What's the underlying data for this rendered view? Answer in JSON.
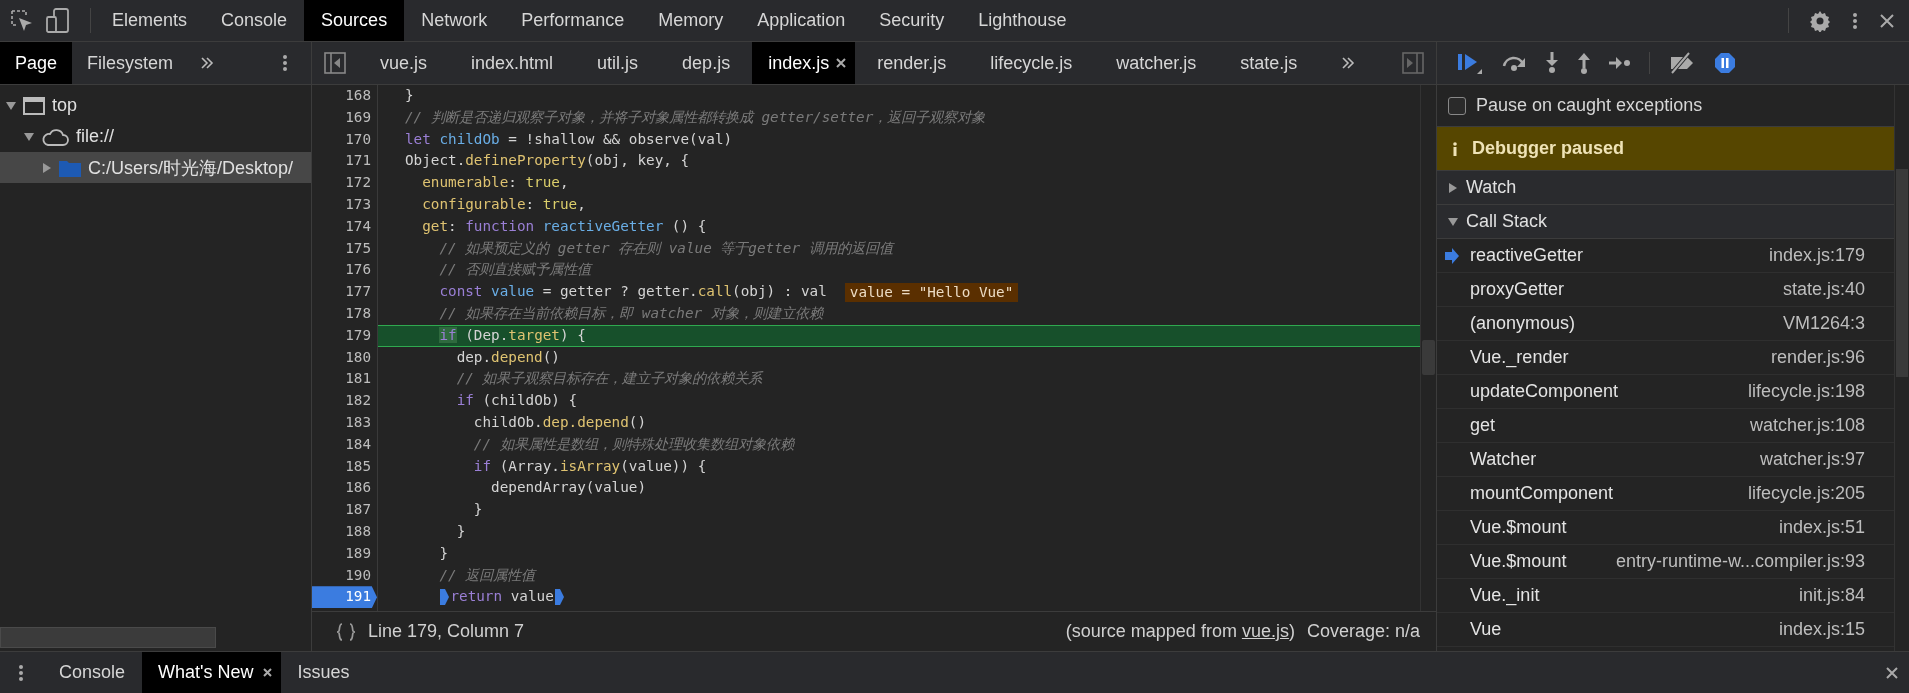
{
  "main_tabs": [
    {
      "label": "Elements",
      "selected": false
    },
    {
      "label": "Console",
      "selected": false
    },
    {
      "label": "Sources",
      "selected": true
    },
    {
      "label": "Network",
      "selected": false
    },
    {
      "label": "Performance",
      "selected": false
    },
    {
      "label": "Memory",
      "selected": false
    },
    {
      "label": "Application",
      "selected": false
    },
    {
      "label": "Security",
      "selected": false
    },
    {
      "label": "Lighthouse",
      "selected": false
    }
  ],
  "navigator": {
    "tabs": [
      {
        "label": "Page",
        "selected": true
      },
      {
        "label": "Filesystem",
        "selected": false
      }
    ],
    "tree": [
      {
        "label": "top",
        "kind": "frame",
        "expanded": true,
        "selected": false,
        "children": [
          {
            "label": "file://",
            "kind": "origin",
            "expanded": true,
            "selected": false,
            "children": [
              {
                "label": "C:/Users/时光海/Desktop/",
                "kind": "folder",
                "expanded": false,
                "selected": true
              }
            ]
          }
        ]
      }
    ]
  },
  "editor": {
    "tabs": [
      {
        "label": "vue.js",
        "selected": false
      },
      {
        "label": "index.html",
        "selected": false
      },
      {
        "label": "util.js",
        "selected": false
      },
      {
        "label": "dep.js",
        "selected": false
      },
      {
        "label": "index.js",
        "selected": true
      },
      {
        "label": "render.js",
        "selected": false
      },
      {
        "label": "lifecycle.js",
        "selected": false
      },
      {
        "label": "watcher.js",
        "selected": false
      },
      {
        "label": "state.js",
        "selected": false
      }
    ],
    "lines": [
      {
        "number": "168",
        "current": false,
        "breakpoint": false,
        "tokens": [
          {
            "kind": "plain",
            "text": "}"
          }
        ]
      },
      {
        "number": "169",
        "current": false,
        "breakpoint": false,
        "tokens": [
          {
            "kind": "comment",
            "text": "// 判断是否递归观察子对象，并将子对象属性都转换成 getter/setter，返回子观察对象"
          }
        ]
      },
      {
        "number": "170",
        "current": false,
        "breakpoint": false,
        "tokens": [
          {
            "kind": "keyword",
            "text": "let"
          },
          {
            "kind": "def",
            "text": " childOb"
          },
          {
            "kind": "plain",
            "text": " = !shallow && observe(val)"
          }
        ]
      },
      {
        "number": "171",
        "current": false,
        "breakpoint": false,
        "tokens": [
          {
            "kind": "plain",
            "text": "Object."
          },
          {
            "kind": "prop",
            "text": "defineProperty"
          },
          {
            "kind": "plain",
            "text": "(obj, key, {"
          }
        ]
      },
      {
        "number": "172",
        "current": false,
        "breakpoint": false,
        "tokens": [
          {
            "kind": "prop",
            "text": "  enumerable"
          },
          {
            "kind": "plain",
            "text": ": "
          },
          {
            "kind": "atom",
            "text": "true"
          },
          {
            "kind": "plain",
            "text": ","
          }
        ]
      },
      {
        "number": "173",
        "current": false,
        "breakpoint": false,
        "tokens": [
          {
            "kind": "prop",
            "text": "  configurable"
          },
          {
            "kind": "plain",
            "text": ": "
          },
          {
            "kind": "atom",
            "text": "true"
          },
          {
            "kind": "plain",
            "text": ","
          }
        ]
      },
      {
        "number": "174",
        "current": false,
        "breakpoint": false,
        "tokens": [
          {
            "kind": "prop",
            "text": "  get"
          },
          {
            "kind": "plain",
            "text": ": "
          },
          {
            "kind": "keyword",
            "text": "function"
          },
          {
            "kind": "def",
            "text": " reactiveGetter"
          },
          {
            "kind": "plain",
            "text": " () {"
          }
        ]
      },
      {
        "number": "175",
        "current": false,
        "breakpoint": false,
        "tokens": [
          {
            "kind": "comment",
            "text": "    // 如果预定义的 getter 存在则 value 等于getter 调用的返回值"
          }
        ]
      },
      {
        "number": "176",
        "current": false,
        "breakpoint": false,
        "tokens": [
          {
            "kind": "comment",
            "text": "    // 否则直接赋予属性值"
          }
        ]
      },
      {
        "number": "177",
        "current": false,
        "breakpoint": false,
        "inline_value": "value = \"Hello Vue\"",
        "tokens": [
          {
            "kind": "keyword",
            "text": "    const"
          },
          {
            "kind": "def",
            "text": " value"
          },
          {
            "kind": "plain",
            "text": " = getter ? getter."
          },
          {
            "kind": "prop",
            "text": "call"
          },
          {
            "kind": "plain",
            "text": "(obj) : val"
          }
        ]
      },
      {
        "number": "178",
        "current": false,
        "breakpoint": false,
        "tokens": [
          {
            "kind": "comment",
            "text": "    // 如果存在当前依赖目标，即 watcher 对象，则建立依赖"
          }
        ]
      },
      {
        "number": "179",
        "current": true,
        "breakpoint": false,
        "tokens": [
          {
            "kind": "keyword",
            "text": "    if"
          },
          {
            "kind": "plain",
            "text": " (Dep."
          },
          {
            "kind": "prop",
            "text": "target"
          },
          {
            "kind": "plain",
            "text": ") {"
          }
        ]
      },
      {
        "number": "180",
        "current": false,
        "breakpoint": false,
        "tokens": [
          {
            "kind": "plain",
            "text": "      dep."
          },
          {
            "kind": "prop",
            "text": "depend"
          },
          {
            "kind": "plain",
            "text": "()"
          }
        ]
      },
      {
        "number": "181",
        "current": false,
        "breakpoint": false,
        "tokens": [
          {
            "kind": "comment",
            "text": "      // 如果子观察目标存在，建立子对象的依赖关系"
          }
        ]
      },
      {
        "number": "182",
        "current": false,
        "breakpoint": false,
        "tokens": [
          {
            "kind": "keyword",
            "text": "      if"
          },
          {
            "kind": "plain",
            "text": " (childOb) {"
          }
        ]
      },
      {
        "number": "183",
        "current": false,
        "breakpoint": false,
        "tokens": [
          {
            "kind": "plain",
            "text": "        childOb."
          },
          {
            "kind": "prop",
            "text": "dep.depend"
          },
          {
            "kind": "plain",
            "text": "()"
          }
        ]
      },
      {
        "number": "184",
        "current": false,
        "breakpoint": false,
        "tokens": [
          {
            "kind": "comment",
            "text": "        // 如果属性是数组，则特殊处理收集数组对象依赖"
          }
        ]
      },
      {
        "number": "185",
        "current": false,
        "breakpoint": false,
        "tokens": [
          {
            "kind": "keyword",
            "text": "        if"
          },
          {
            "kind": "plain",
            "text": " (Array."
          },
          {
            "kind": "prop",
            "text": "isArray"
          },
          {
            "kind": "plain",
            "text": "(value)) {"
          }
        ]
      },
      {
        "number": "186",
        "current": false,
        "breakpoint": false,
        "tokens": [
          {
            "kind": "plain",
            "text": "          dependArray(value)"
          }
        ]
      },
      {
        "number": "187",
        "current": false,
        "breakpoint": false,
        "tokens": [
          {
            "kind": "plain",
            "text": "        }"
          }
        ]
      },
      {
        "number": "188",
        "current": false,
        "breakpoint": false,
        "tokens": [
          {
            "kind": "plain",
            "text": "      }"
          }
        ]
      },
      {
        "number": "189",
        "current": false,
        "breakpoint": false,
        "tokens": [
          {
            "kind": "plain",
            "text": "    }"
          }
        ]
      },
      {
        "number": "190",
        "current": false,
        "breakpoint": false,
        "tokens": [
          {
            "kind": "comment",
            "text": "    // 返回属性值"
          }
        ]
      },
      {
        "number": "191",
        "current": false,
        "breakpoint": true,
        "tokens": [
          {
            "kind": "keyword",
            "text": "    return"
          },
          {
            "kind": "plain",
            "text": " value"
          }
        ]
      }
    ],
    "status": {
      "position": "Line 179, Column 7",
      "source_map_prefix": "(source mapped from ",
      "source_map_link": "vue.js",
      "source_map_suffix": ")",
      "coverage": "Coverage: n/a"
    }
  },
  "debugger": {
    "paused": true,
    "pause_on_exceptions": true,
    "pause_on_caught": {
      "label": "Pause on caught exceptions",
      "checked": false
    },
    "banner": "Debugger paused",
    "sections": [
      {
        "title": "Watch",
        "expanded": false
      },
      {
        "title": "Call Stack",
        "expanded": true
      }
    ],
    "call_stack": [
      {
        "function": "reactiveGetter",
        "location": "index.js:179",
        "selected": true
      },
      {
        "function": "proxyGetter",
        "location": "state.js:40",
        "selected": false
      },
      {
        "function": "(anonymous)",
        "location": "VM1264:3",
        "selected": false
      },
      {
        "function": "Vue._render",
        "location": "render.js:96",
        "selected": false
      },
      {
        "function": "updateComponent",
        "location": "lifecycle.js:198",
        "selected": false
      },
      {
        "function": "get",
        "location": "watcher.js:108",
        "selected": false
      },
      {
        "function": "Watcher",
        "location": "watcher.js:97",
        "selected": false
      },
      {
        "function": "mountComponent",
        "location": "lifecycle.js:205",
        "selected": false
      },
      {
        "function": "Vue.$mount",
        "location": "index.js:51",
        "selected": false
      },
      {
        "function": "Vue.$mount",
        "location": "entry-runtime-w...compiler.js:93",
        "selected": false
      },
      {
        "function": "Vue._init",
        "location": "init.js:84",
        "selected": false
      },
      {
        "function": "Vue",
        "location": "index.js:15",
        "selected": false
      }
    ]
  },
  "drawer": {
    "tabs": [
      {
        "label": "Console",
        "selected": false
      },
      {
        "label": "What's New",
        "selected": true
      },
      {
        "label": "Issues",
        "selected": false
      }
    ]
  }
}
